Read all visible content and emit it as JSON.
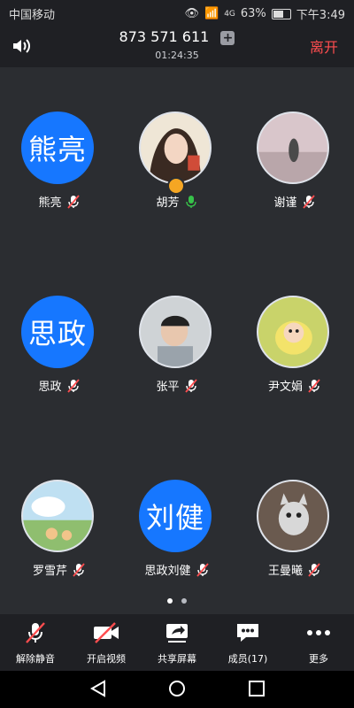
{
  "status_bar": {
    "carrier": "中国移动",
    "signal_text": "4G",
    "battery": "63%",
    "time": "下午3:49"
  },
  "header": {
    "meeting_id": "873 571 611",
    "duration": "01:24:35",
    "leave_label": "离开"
  },
  "participants": [
    {
      "name": "熊亮",
      "avatar_text": "熊亮",
      "avatar_type": "text",
      "mic": "muted"
    },
    {
      "name": "胡芳",
      "avatar_type": "image",
      "mic": "active",
      "host_badge": true
    },
    {
      "name": "谢谨",
      "avatar_type": "image",
      "mic": "muted"
    },
    {
      "name": "思政",
      "avatar_text": "思政",
      "avatar_type": "text",
      "mic": "muted"
    },
    {
      "name": "张平",
      "avatar_type": "image",
      "mic": "muted"
    },
    {
      "name": "尹文娟",
      "avatar_type": "image",
      "mic": "muted"
    },
    {
      "name": "罗雪芹",
      "avatar_type": "image",
      "mic": "muted"
    },
    {
      "name": "思政刘健",
      "avatar_text": "刘健",
      "avatar_type": "text",
      "mic": "muted"
    },
    {
      "name": "王曼曦",
      "avatar_type": "image",
      "mic": "muted"
    }
  ],
  "toolbar": {
    "unmute_label": "解除静音",
    "video_label": "开启视频",
    "share_label": "共享屏幕",
    "members_label": "成员(17)",
    "more_label": "更多"
  },
  "pager": {
    "pages": 2,
    "current": 1
  },
  "colors": {
    "accent": "#1677ff",
    "leave": "#ff4d4f",
    "mic_muted": "#ff4d4f",
    "mic_active": "#37c24a"
  }
}
